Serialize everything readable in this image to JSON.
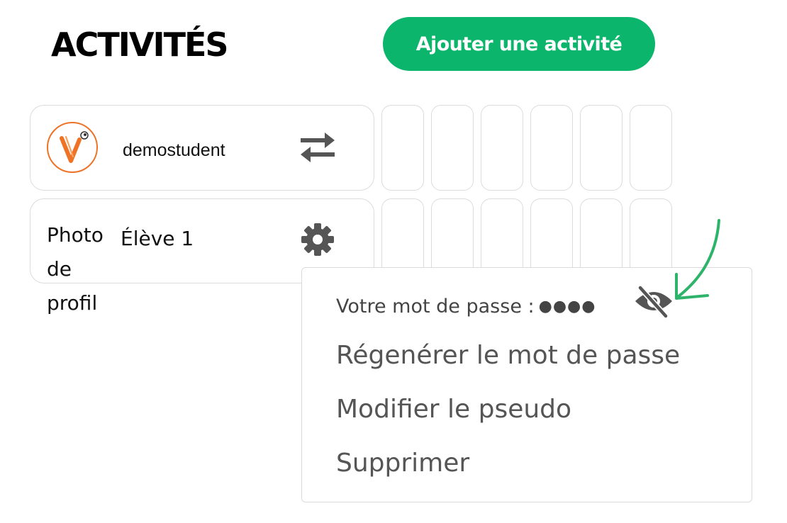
{
  "header": {
    "title": "ACTIVITÉS",
    "add_button_label": "Ajouter une activité"
  },
  "rows": [
    {
      "username": "demostudent",
      "avatar": "brand-logo-v",
      "action_icon": "swap-arrows-icon"
    },
    {
      "photo_alt": "Photo de profil",
      "name": "Élève 1",
      "action_icon": "gear-icon"
    }
  ],
  "menu": {
    "password_label": "Votre mot de passe :",
    "password_masked": "●●●●",
    "visibility_icon": "eye-slash-icon",
    "items": [
      "Régenérer le mot de passe",
      "Modifier le pseudo",
      "Supprimer"
    ]
  },
  "colors": {
    "accent_green": "#0bb56b",
    "logo_orange": "#ee7326",
    "annotation_green": "#2db46a",
    "icon_gray": "#555555",
    "border_gray": "#dcdcdc"
  }
}
